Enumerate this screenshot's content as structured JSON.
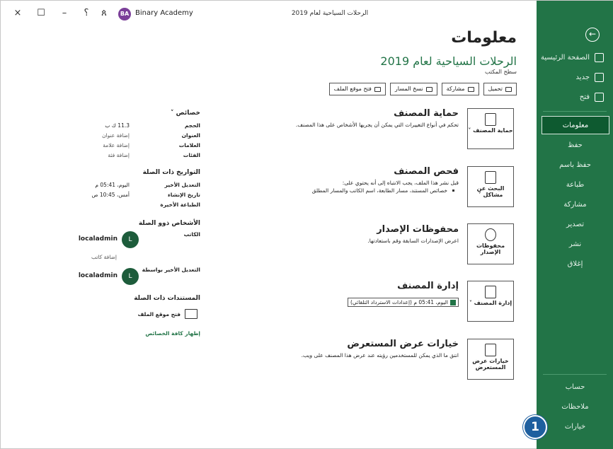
{
  "window": {
    "title": "الرحلات السياحية لعام 2019",
    "user_initials": "BA",
    "user_name": "Binary Academy",
    "ctrl_close": "×",
    "ctrl_restore": "☐",
    "ctrl_minimize": "–",
    "ctrl_help": "؟",
    "ctrl_share": "ጰ"
  },
  "sidebar": {
    "back": "←",
    "items": [
      {
        "label": "الصفحة الرئيسية",
        "icon": "home-icon"
      },
      {
        "label": "جديد",
        "icon": "new-file-icon"
      },
      {
        "label": "فتح",
        "icon": "folder-icon"
      },
      {
        "label": "معلومات",
        "active": true
      },
      {
        "label": "حفظ"
      },
      {
        "label": "حفظ باسم"
      },
      {
        "label": "طباعة"
      },
      {
        "label": "مشاركة"
      },
      {
        "label": "تصدير"
      },
      {
        "label": "نشر"
      },
      {
        "label": "إغلاق"
      },
      {
        "label": "حساب"
      },
      {
        "label": "ملاحظات"
      },
      {
        "label": "خيارات"
      }
    ],
    "callout": "1"
  },
  "main": {
    "page_title": "معلومات",
    "doc_title": "الرحلات السياحية لعام 2019",
    "doc_path": "سطح المكتب",
    "buttons": [
      "تحميل",
      "مشاركة",
      "نسخ المسار",
      "فتح موقع الملف"
    ]
  },
  "sections": [
    {
      "card": "حماية المصنف ˅",
      "title": "حماية المصنف",
      "desc": "تحكم في أنواع التغييرات التي يمكن أن يجريها الأشخاص على هذا المصنف."
    },
    {
      "card": "البحث عن مشاكل ˅",
      "title": "فحص المصنف",
      "desc": "قبل نشر هذا الملف، يجب الانتباه إلى أنه يحتوي على:",
      "bullet": "خصائص المستند، مسار الطابعة، اسم الكاتب والمسار المطلق"
    },
    {
      "card": "محفوظات الإصدار",
      "title": "محفوظات الإصدار",
      "desc": "اعرض الإصدارات السابقة وقم باستعادتها."
    },
    {
      "card": "إدارة المصنف ˅",
      "title": "إدارة المصنف",
      "version": "اليوم، 05:41 م (إعدادات الاسترداد التلقائي)"
    },
    {
      "card": "خيارات عرض المستعرض",
      "title": "خيارات عرض المستعرض",
      "desc": "انتق ما الذي يمكن للمستخدمين رؤيته عند عرض هذا المصنف على ويب."
    }
  ],
  "properties": {
    "header": "خصائص ˅",
    "rows": [
      {
        "label": "الحجم",
        "value": "11.3 ك ب"
      },
      {
        "label": "العنوان",
        "value": "إضافة عنوان"
      },
      {
        "label": "العلامات",
        "value": "إضافة علامة"
      },
      {
        "label": "الفئات",
        "value": "إضافة فئة"
      }
    ],
    "dates_header": "التواريخ ذات الصلة",
    "dates": [
      {
        "label": "التعديل الأخير",
        "value": "اليوم، 05:41 م"
      },
      {
        "label": "تاريخ الإنشاء",
        "value": "أمس، 10:45 ص"
      },
      {
        "label": "الطباعة الأخيرة",
        "value": ""
      }
    ],
    "people_header": "الأشخاص ذوو الصلة",
    "author_label": "الكاتب",
    "author_initial": "L",
    "author_name": "localadmin",
    "add_author": "إضافة كاتب",
    "modified_by_label": "التعديل الأخير بواسطة",
    "modifier_initial": "L",
    "modifier_name": "localadmin",
    "docs_header": "المستندات ذات الصلة",
    "open_location": "فتح موقع الملف",
    "show_all": "إظهار كافة الخصائص"
  }
}
